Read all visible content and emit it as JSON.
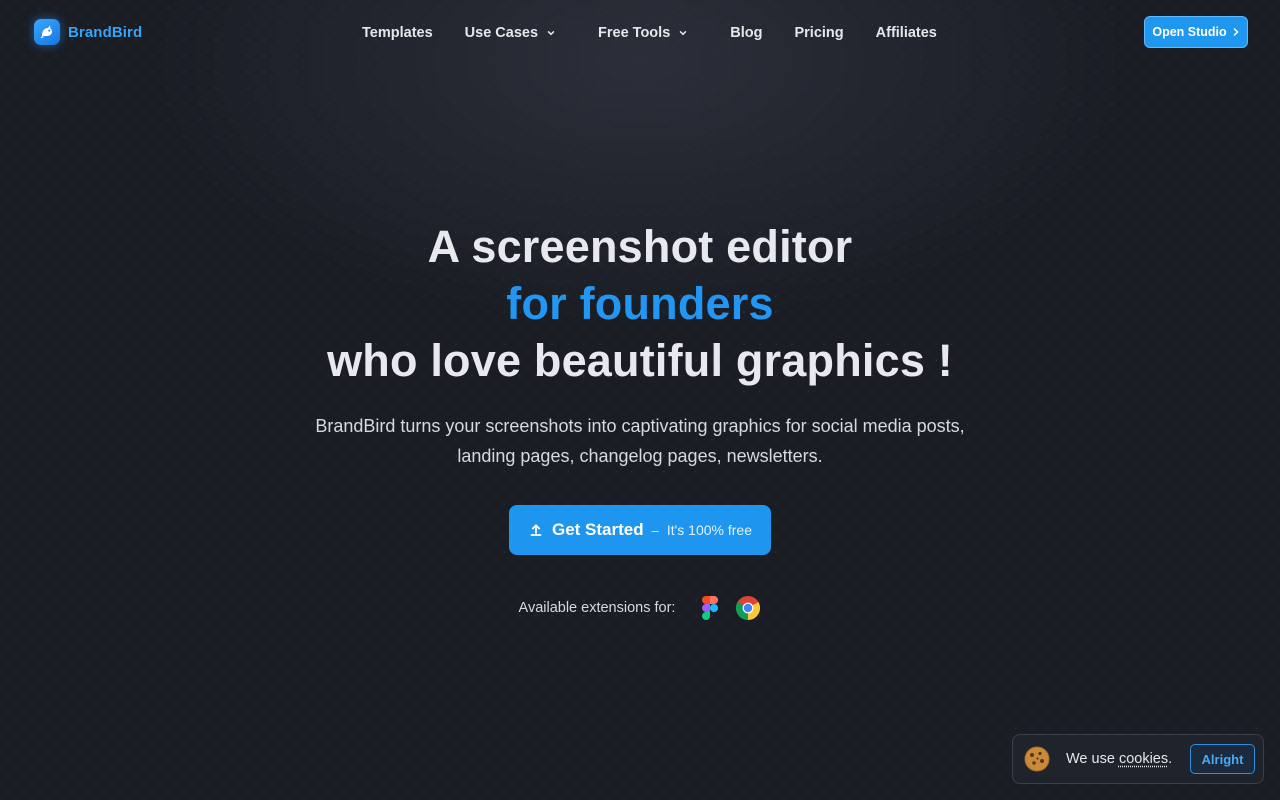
{
  "brand": {
    "name": "BrandBird",
    "accent": "#2196f3",
    "logo_icon": "brandbird-logo-icon"
  },
  "nav": {
    "items": [
      {
        "label": "Templates",
        "dropdown": false
      },
      {
        "label": "Use Cases",
        "dropdown": true
      },
      {
        "label": "Free Tools",
        "dropdown": true
      },
      {
        "label": "Blog",
        "dropdown": false
      },
      {
        "label": "Pricing",
        "dropdown": false
      },
      {
        "label": "Affiliates",
        "dropdown": false
      }
    ],
    "cta_label": "Open Studio"
  },
  "hero": {
    "line1": "A screenshot editor",
    "line2": "for founders",
    "line3": "who love beautiful graphics !",
    "subtitle": "BrandBird turns your screenshots into captivating graphics for social media posts, landing pages, changelog pages, newsletters.",
    "cta": {
      "icon": "upload-icon",
      "label": "Get Started",
      "dash": "–",
      "note": "It's 100% free"
    },
    "extensions": {
      "label": "Available extensions for:",
      "icons": [
        "figma-icon",
        "chrome-icon"
      ]
    }
  },
  "cookie_banner": {
    "icon": "cookie-icon",
    "text_prefix": "We use ",
    "link": "cookies",
    "text_suffix": ".",
    "button": "Alright"
  },
  "colors": {
    "background": "#1a1d24",
    "primary_button": "#1e95ee",
    "text": "#e5e7eb"
  }
}
